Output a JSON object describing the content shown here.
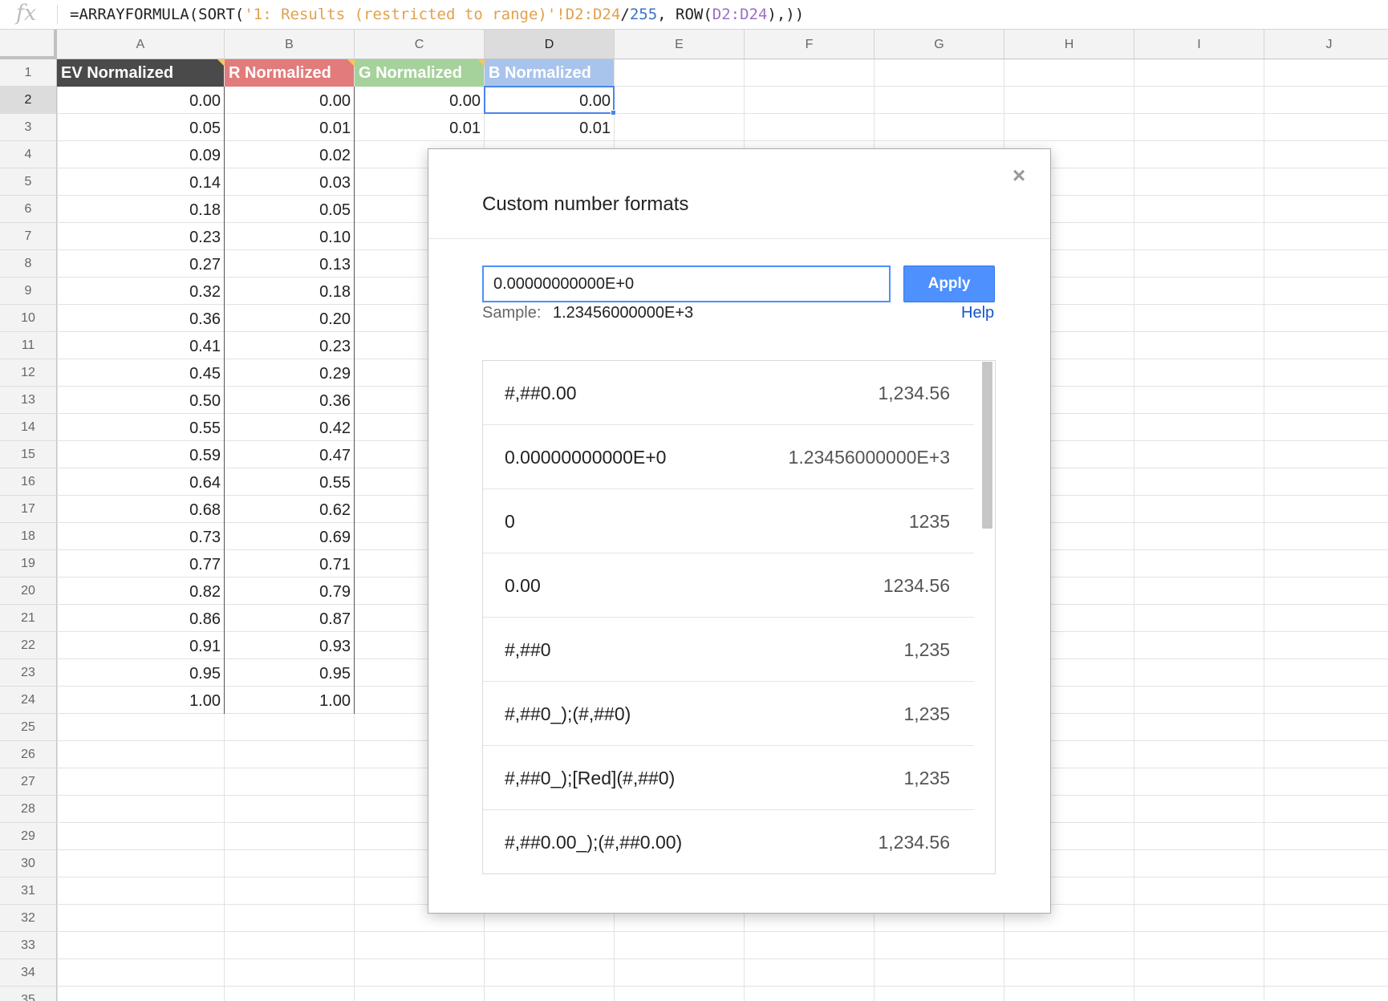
{
  "formula_bar": {
    "fx": "fx",
    "parts": [
      {
        "text": "=ARRAYFORMULA(SORT(",
        "cls": ""
      },
      {
        "text": "'1: Results (restricted to range)'!",
        "cls": "f-str"
      },
      {
        "text": "D2:D24",
        "cls": "f-ref1"
      },
      {
        "text": "/",
        "cls": ""
      },
      {
        "text": "255",
        "cls": "f-num"
      },
      {
        "text": ", ROW(",
        "cls": ""
      },
      {
        "text": "D2:D24",
        "cls": "f-ref2"
      },
      {
        "text": "),))",
        "cls": ""
      }
    ]
  },
  "columns": [
    "A",
    "B",
    "C",
    "D",
    "E",
    "F",
    "G",
    "H",
    "I",
    "J"
  ],
  "selected_column": "D",
  "rows": [
    "1",
    "2",
    "3",
    "4",
    "5",
    "6",
    "7",
    "8",
    "9",
    "10",
    "11",
    "12",
    "13",
    "14",
    "15",
    "16",
    "17",
    "18",
    "19",
    "20",
    "21",
    "22",
    "23",
    "24",
    "25",
    "26",
    "27",
    "28",
    "29",
    "30",
    "31",
    "32",
    "33",
    "34",
    "35"
  ],
  "selected_row": "2",
  "header_cells": [
    {
      "label": "EV Normalized",
      "color": "#4a4a4a"
    },
    {
      "label": "R Normalized",
      "color": "#e27b7b"
    },
    {
      "label": "G Normalized",
      "color": "#a5d19b"
    },
    {
      "label": "B Normalized",
      "color": "#a9c4ec"
    }
  ],
  "col_a": [
    "0.00",
    "0.05",
    "0.09",
    "0.14",
    "0.18",
    "0.23",
    "0.27",
    "0.32",
    "0.36",
    "0.41",
    "0.45",
    "0.50",
    "0.55",
    "0.59",
    "0.64",
    "0.68",
    "0.73",
    "0.77",
    "0.82",
    "0.86",
    "0.91",
    "0.95",
    "1.00"
  ],
  "col_b": [
    "0.00",
    "0.01",
    "0.02",
    "0.03",
    "0.05",
    "0.10",
    "0.13",
    "0.18",
    "0.20",
    "0.23",
    "0.29",
    "0.36",
    "0.42",
    "0.47",
    "0.55",
    "0.62",
    "0.69",
    "0.71",
    "0.79",
    "0.87",
    "0.93",
    "0.95",
    "1.00"
  ],
  "col_c": [
    "0.00",
    "0.01"
  ],
  "col_d": [
    "0.00",
    "0.01"
  ],
  "dialog": {
    "title": "Custom number formats",
    "close": "×",
    "input_value": "0.00000000000E+0",
    "apply_label": "Apply",
    "sample_label": "Sample:",
    "sample_value": "1.23456000000E+3",
    "help_label": "Help",
    "formats": [
      {
        "code": "#,##0.00",
        "sample": "1,234.56"
      },
      {
        "code": "0.00000000000E+0",
        "sample": "1.23456000000E+3"
      },
      {
        "code": "0",
        "sample": "1235"
      },
      {
        "code": "0.00",
        "sample": "1234.56"
      },
      {
        "code": "#,##0",
        "sample": "1,235"
      },
      {
        "code": "#,##0_);(#,##0)",
        "sample": "1,235"
      },
      {
        "code": "#,##0_);[Red](#,##0)",
        "sample": "1,235"
      },
      {
        "code": "#,##0.00_);(#,##0.00)",
        "sample": "1,234.56"
      }
    ]
  }
}
